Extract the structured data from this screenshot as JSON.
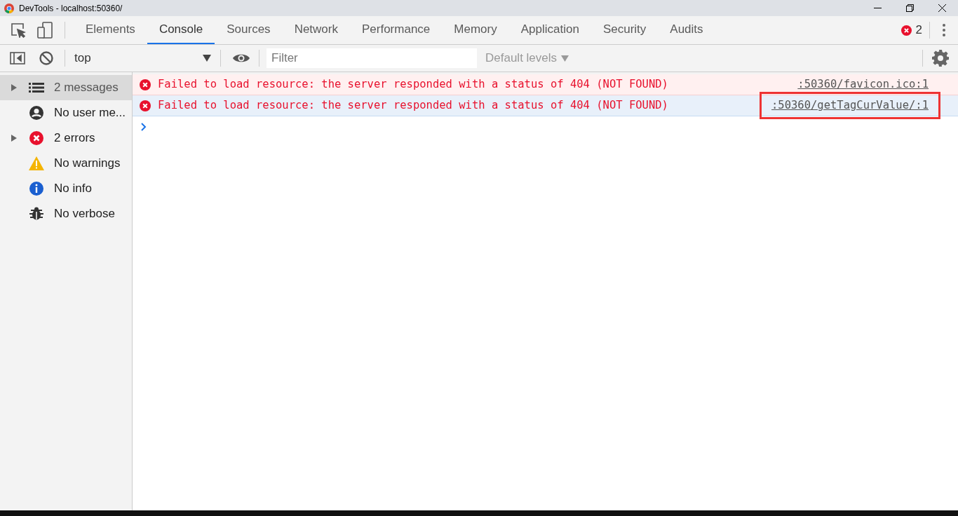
{
  "window": {
    "title": "DevTools - localhost:50360/"
  },
  "tabs": [
    {
      "label": "Elements",
      "selected": false
    },
    {
      "label": "Console",
      "selected": true
    },
    {
      "label": "Sources",
      "selected": false
    },
    {
      "label": "Network",
      "selected": false
    },
    {
      "label": "Performance",
      "selected": false
    },
    {
      "label": "Memory",
      "selected": false
    },
    {
      "label": "Application",
      "selected": false
    },
    {
      "label": "Security",
      "selected": false
    },
    {
      "label": "Audits",
      "selected": false
    }
  ],
  "error_count": "2",
  "toolbar": {
    "context": "top",
    "filter": {
      "placeholder": "Filter"
    },
    "levels": "Default levels"
  },
  "sidebar": {
    "items": [
      {
        "kind": "messages",
        "label": "2 messages",
        "expandable": true,
        "selected": true
      },
      {
        "kind": "user",
        "label": "No user me...",
        "expandable": false,
        "selected": false
      },
      {
        "kind": "error",
        "label": "2 errors",
        "expandable": true,
        "selected": false
      },
      {
        "kind": "warning",
        "label": "No warnings",
        "expandable": false,
        "selected": false
      },
      {
        "kind": "info",
        "label": "No info",
        "expandable": false,
        "selected": false
      },
      {
        "kind": "verbose",
        "label": "No verbose",
        "expandable": false,
        "selected": false
      }
    ]
  },
  "messages": [
    {
      "text": "Failed to load resource: the server responded with a status of 404 (NOT FOUND)",
      "source": ":50360/favicon.ico:1",
      "selected": false,
      "highlighted": false
    },
    {
      "text": "Failed to load resource: the server responded with a status of 404 (NOT FOUND)",
      "source": ":50360/getTagCurValue/:1",
      "selected": true,
      "highlighted": true
    }
  ]
}
